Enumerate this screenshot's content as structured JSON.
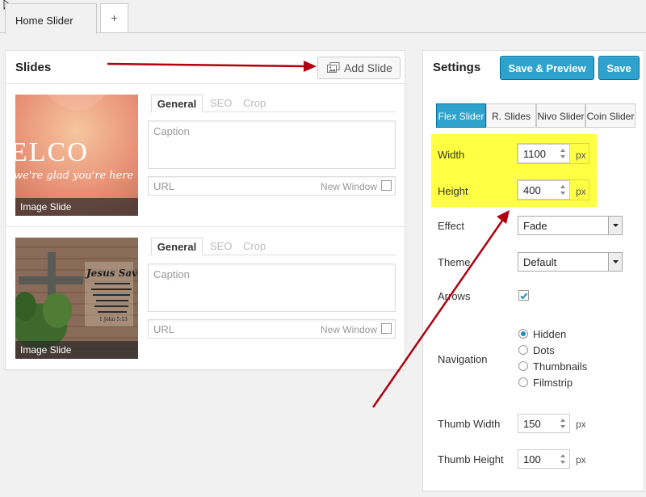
{
  "tabs": {
    "main": "Home Slider",
    "add": "+"
  },
  "slides": {
    "title": "Slides",
    "add_button": "Add Slide",
    "items": [
      {
        "tabs": [
          "General",
          "SEO",
          "Crop"
        ],
        "caption_placeholder": "Caption",
        "url_placeholder": "URL",
        "new_window": "New Window",
        "label": "Image Slide",
        "image_text_big": "ELCO",
        "image_text_small": "we're glad you're here"
      },
      {
        "tabs": [
          "General",
          "SEO",
          "Crop"
        ],
        "caption_placeholder": "Caption",
        "url_placeholder": "URL",
        "new_window": "New Window",
        "label": "Image Slide",
        "image_text_big": "Jesus Saves",
        "image_text_small": "1 John 5:13"
      }
    ]
  },
  "settings": {
    "title": "Settings",
    "save_preview": "Save & Preview",
    "save": "Save",
    "types": [
      "Flex Slider",
      "R. Slides",
      "Nivo Slider",
      "Coin Slider"
    ],
    "width_label": "Width",
    "width_value": "1100",
    "width_unit": "px",
    "height_label": "Height",
    "height_value": "400",
    "height_unit": "px",
    "effect_label": "Effect",
    "effect_value": "Fade",
    "theme_label": "Theme",
    "theme_value": "Default",
    "arrows_label": "Arrows",
    "arrows_checked": true,
    "navigation_label": "Navigation",
    "navigation_options": [
      "Hidden",
      "Dots",
      "Thumbnails",
      "Filmstrip"
    ],
    "navigation_selected": "Hidden",
    "thumb_width_label": "Thumb Width",
    "thumb_width_value": "150",
    "thumb_width_unit": "px",
    "thumb_height_label": "Thumb Height",
    "thumb_height_value": "100",
    "thumb_height_unit": "px"
  },
  "colors": {
    "accent": "#2ea2cc",
    "highlight": "#ffff44",
    "annotation_arrow": "#b00010"
  }
}
